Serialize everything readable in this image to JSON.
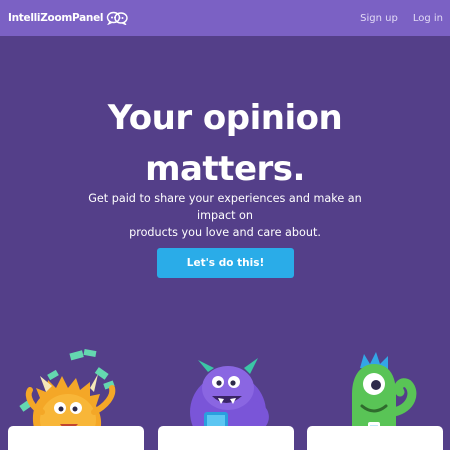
{
  "nav": {
    "brand": "IntelliZoomPanel",
    "links": [
      "Sign up",
      "Log in"
    ]
  },
  "hero": {
    "title_line1": "Your opinion",
    "title_line2": "matters.",
    "subtitle_line1": "Get paid to share your experiences and make an impact on",
    "subtitle_line2": "products you love and care about.",
    "cta": "Let's do this!"
  },
  "colors": {
    "background": "#543f89",
    "navbar": "#7b61c4",
    "cta": "#2aace8"
  },
  "icons": [
    "chat-bubbles-logo-icon"
  ]
}
